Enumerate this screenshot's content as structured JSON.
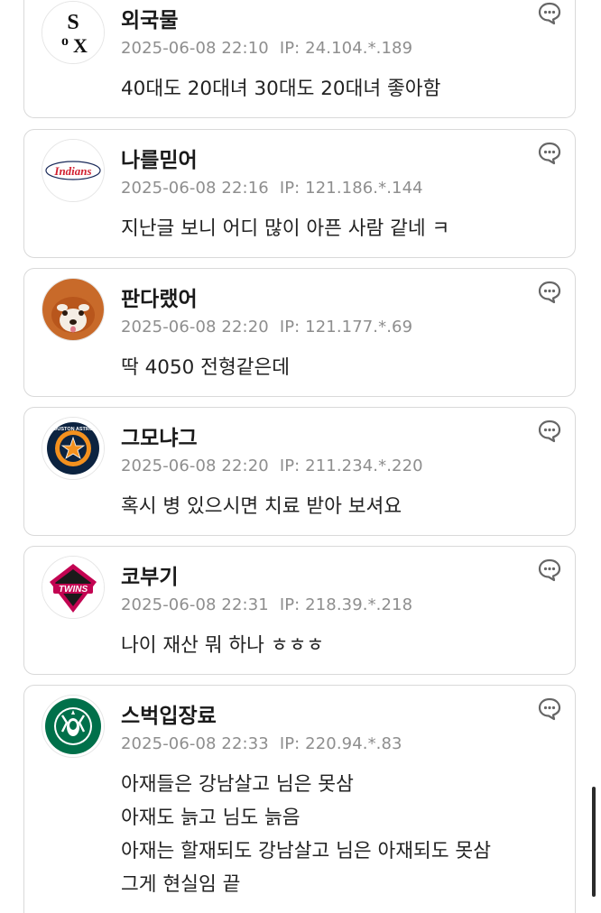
{
  "comments": [
    {
      "nickname": "외국물",
      "date": "2025-06-08 22:10",
      "ip_label": "IP:",
      "ip": "24.104.*.189",
      "lines": [
        "40대도 20대녀 30대도 20대녀 좋아함"
      ],
      "avatar": "white-sox-logo"
    },
    {
      "nickname": "나를믿어",
      "date": "2025-06-08 22:16",
      "ip_label": "IP:",
      "ip": "121.186.*.144",
      "lines": [
        "지난글 보니 어디 많이 아픈 사람 같네 ㅋ"
      ],
      "avatar": "indians-logo",
      "avatar_text": "Indians"
    },
    {
      "nickname": "판다랬어",
      "date": "2025-06-08 22:20",
      "ip_label": "IP:",
      "ip": "121.177.*.69",
      "lines": [
        "딱 4050 전형같은데"
      ],
      "avatar": "red-panda-photo"
    },
    {
      "nickname": "그모냐그",
      "date": "2025-06-08 22:20",
      "ip_label": "IP:",
      "ip": "211.234.*.220",
      "lines": [
        "혹시 병 있으시면 치료 받아 보셔요"
      ],
      "avatar": "astros-logo",
      "avatar_text": "HOUSTON ASTROS"
    },
    {
      "nickname": "코부기",
      "date": "2025-06-08 22:31",
      "ip_label": "IP:",
      "ip": "218.39.*.218",
      "lines": [
        "나이 재산 뭐 하나 ㅎㅎㅎ"
      ],
      "avatar": "lg-twins-logo",
      "avatar_text": "TWINS"
    },
    {
      "nickname": "스벅입장료",
      "date": "2025-06-08 22:33",
      "ip_label": "IP:",
      "ip": "220.94.*.83",
      "lines": [
        "아재들은 강남살고 님은 못삼",
        "아재도 늙고 님도 늙음",
        "아재는 할재되도 강남살고 님은 아재되도 못삼",
        "그게 현실임 끝"
      ],
      "avatar": "starbucks-logo"
    }
  ],
  "colors": {
    "card_border": "#d9d9d9",
    "nickname": "#1a1a1a",
    "meta": "#8e8e8e",
    "body": "#222222",
    "icon": "#666666"
  },
  "icons": {
    "reply": "speech-bubble-icon"
  }
}
